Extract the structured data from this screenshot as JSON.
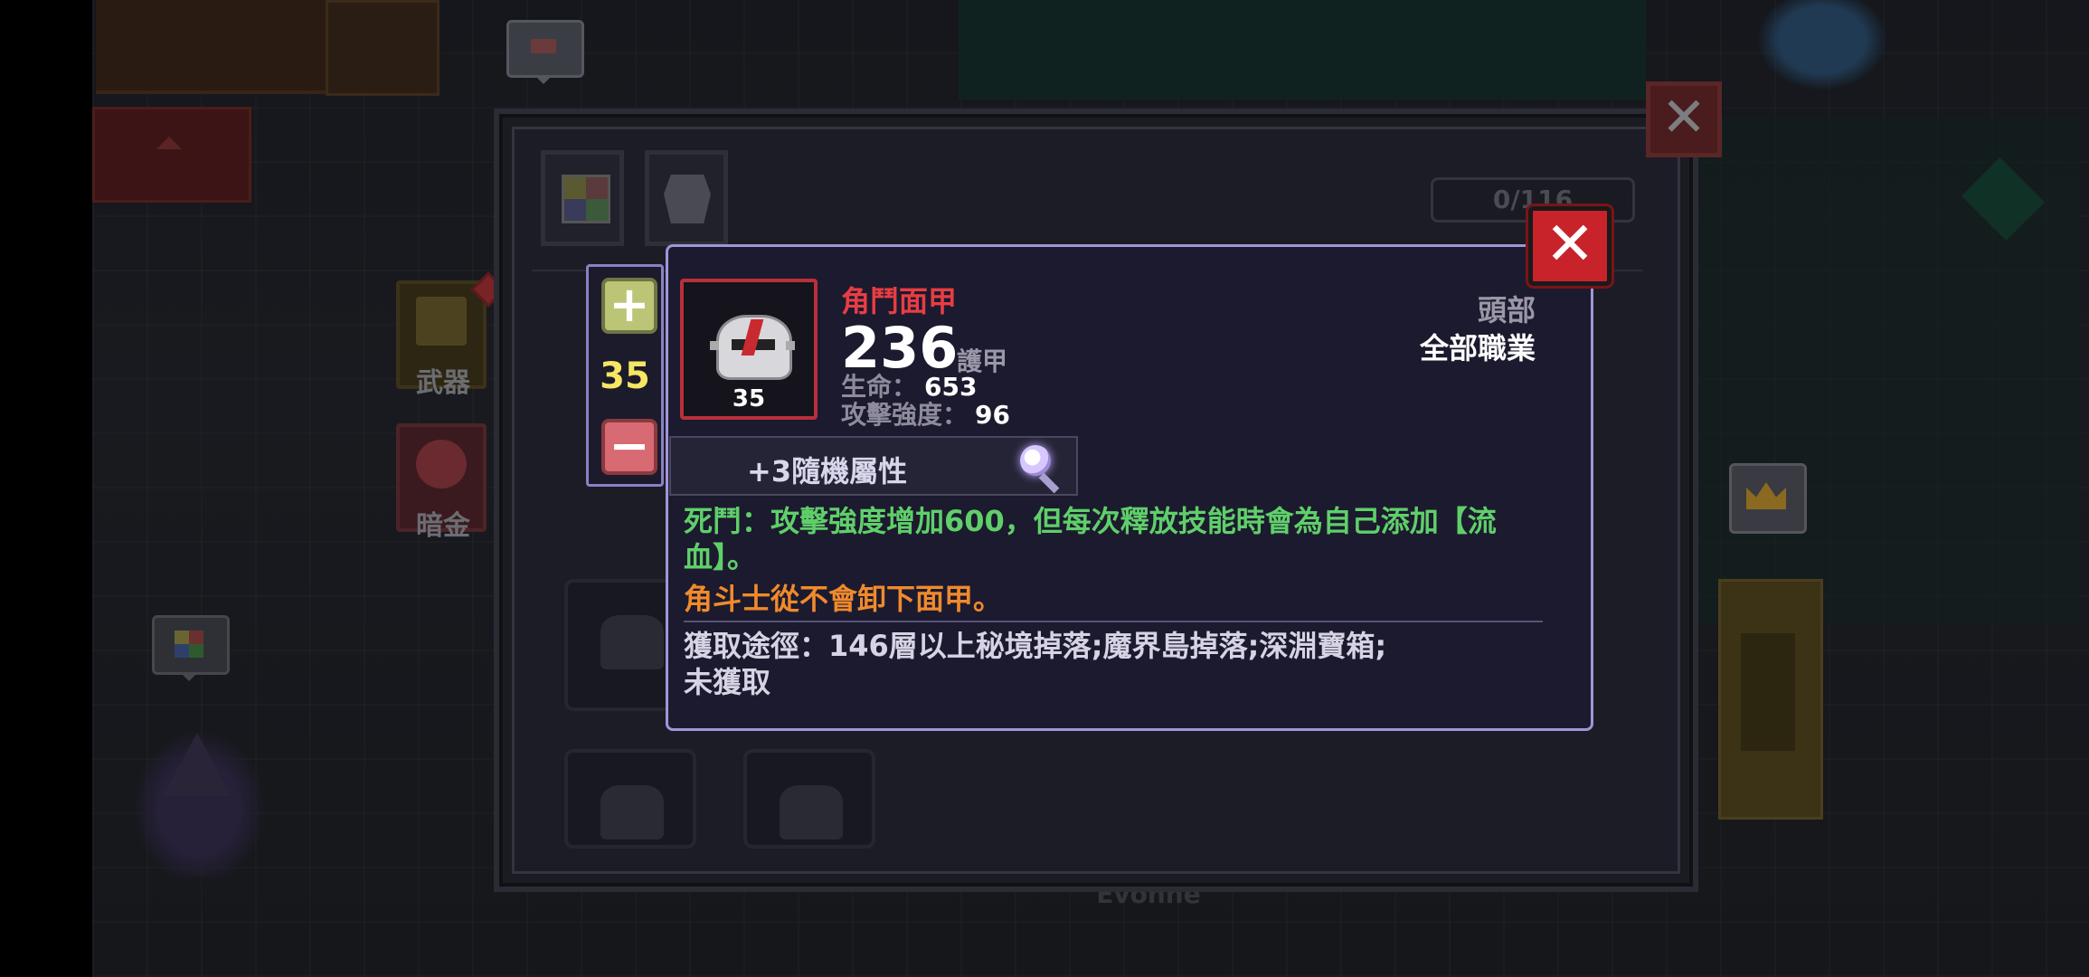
{
  "background": {
    "side_buttons": [
      {
        "label": "武器"
      },
      {
        "label": "暗金"
      }
    ],
    "npc_name": "Evonne"
  },
  "inventory": {
    "counter": "0/116",
    "close_icon": "✕"
  },
  "level_control": {
    "plus_icon": "+",
    "minus_icon": "−",
    "value": "35"
  },
  "tooltip": {
    "close_icon": "✕",
    "item_level": "35",
    "name": "角鬥面甲",
    "armor_value": "236",
    "armor_label": "護甲",
    "stats": [
      {
        "label": "生命：",
        "value": "653"
      },
      {
        "label": "攻擊強度：",
        "value": "96"
      }
    ],
    "slot": "頭部",
    "class": "全部職業",
    "random_attributes": "+3隨機屬性",
    "effect": "死鬥：攻擊強度增加600，但每次釋放技能時會為自己添加【流血】。",
    "flavor": "角斗士從不會卸下面甲。",
    "source": "獲取途徑：146層以上秘境掉落;魔界島掉落;深淵寶箱;",
    "status": "未獲取",
    "colors": {
      "name": "#e83d44",
      "effect": "#5fcf6a",
      "flavor": "#f08a2c",
      "border": "#a195d8",
      "level": "#f5e663"
    }
  }
}
